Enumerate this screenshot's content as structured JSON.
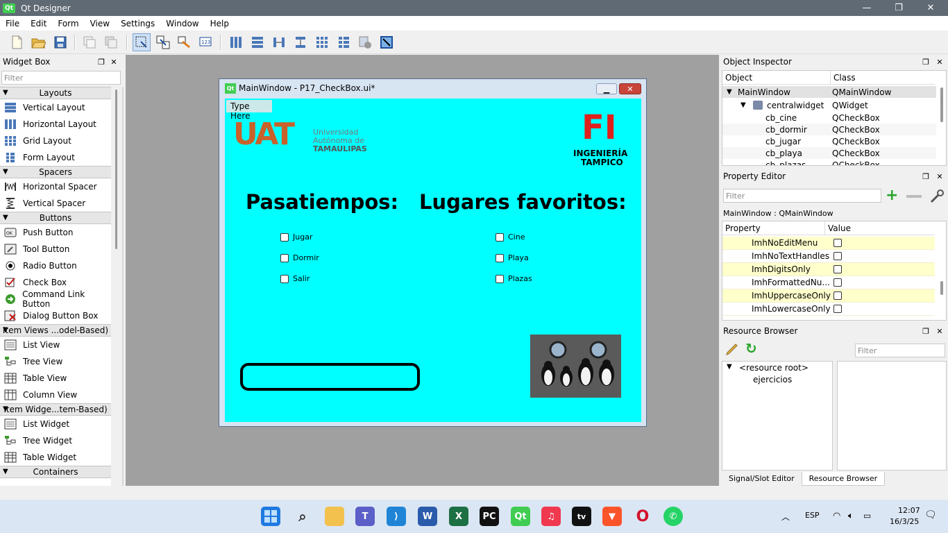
{
  "app": {
    "title": "Qt Designer",
    "logo": "Qt"
  },
  "window_controls": {
    "minimize": "—",
    "maximize": "❐",
    "close": "✕"
  },
  "menubar": [
    "File",
    "Edit",
    "Form",
    "View",
    "Settings",
    "Window",
    "Help"
  ],
  "widget_box": {
    "title": "Widget Box",
    "filter_placeholder": "Filter",
    "sections": [
      {
        "label": "Layouts",
        "items": [
          "Vertical Layout",
          "Horizontal Layout",
          "Grid Layout",
          "Form Layout"
        ]
      },
      {
        "label": "Spacers",
        "items": [
          "Horizontal Spacer",
          "Vertical Spacer"
        ]
      },
      {
        "label": "Buttons",
        "items": [
          "Push Button",
          "Tool Button",
          "Radio Button",
          "Check Box",
          "Command Link Button",
          "Dialog Button Box"
        ]
      },
      {
        "label": "Item Views ...odel-Based)",
        "items": [
          "List View",
          "Tree View",
          "Table View",
          "Column View"
        ]
      },
      {
        "label": "Item Widge...tem-Based)",
        "items": [
          "List Widget",
          "Tree Widget",
          "Table Widget"
        ]
      },
      {
        "label": "Containers",
        "items": []
      }
    ]
  },
  "form": {
    "qt_logo": "Qt",
    "title": "MainWindow - P17_CheckBox.ui*",
    "type_here": "Type Here",
    "uat_logo": {
      "big": "UAT",
      "line1": "Universidad",
      "line2": "Autónoma de",
      "line3": "TAMAULIPAS"
    },
    "fi_logo": {
      "big": "FI",
      "line1": "INGENIERÍA",
      "line2": "TAMPICO"
    },
    "heading_left": "Pasatiempos:",
    "heading_right": "Lugares favoritos:",
    "checks_left": [
      "Jugar",
      "Dormir",
      "Salir"
    ],
    "checks_right": [
      "Cine",
      "Playa",
      "Plazas"
    ]
  },
  "object_inspector": {
    "title": "Object Inspector",
    "col_object": "Object",
    "col_class": "Class",
    "rows": [
      {
        "object": "MainWindow",
        "class": "QMainWindow"
      },
      {
        "object": "centralwidget",
        "class": "QWidget"
      },
      {
        "object": "cb_cine",
        "class": "QCheckBox"
      },
      {
        "object": "cb_dormir",
        "class": "QCheckBox"
      },
      {
        "object": "cb_jugar",
        "class": "QCheckBox"
      },
      {
        "object": "cb_playa",
        "class": "QCheckBox"
      },
      {
        "object": "cb_plazas",
        "class": "QCheckBox"
      }
    ]
  },
  "property_editor": {
    "title": "Property Editor",
    "filter_placeholder": "Filter",
    "context": "MainWindow : QMainWindow",
    "col_property": "Property",
    "col_value": "Value",
    "rows": [
      "ImhNoEditMenu",
      "ImhNoTextHandles",
      "ImhDigitsOnly",
      "ImhFormattedNu...",
      "ImhUppercaseOnly",
      "ImhLowercaseOnly"
    ]
  },
  "resource_browser": {
    "title": "Resource Browser",
    "filter_placeholder": "Filter",
    "root": "<resource root>",
    "child": "ejercicios"
  },
  "bottom_tabs": [
    "Signal/Slot Editor",
    "Resource Browser"
  ],
  "taskbar": {
    "lang": "ESP",
    "time": "12:07",
    "date": "16/3/25"
  },
  "colors": {
    "form_bg": "#00ffff",
    "uat_orange": "#c8612a",
    "fi_red": "#e0201c",
    "property_row": "#ffffcc"
  }
}
